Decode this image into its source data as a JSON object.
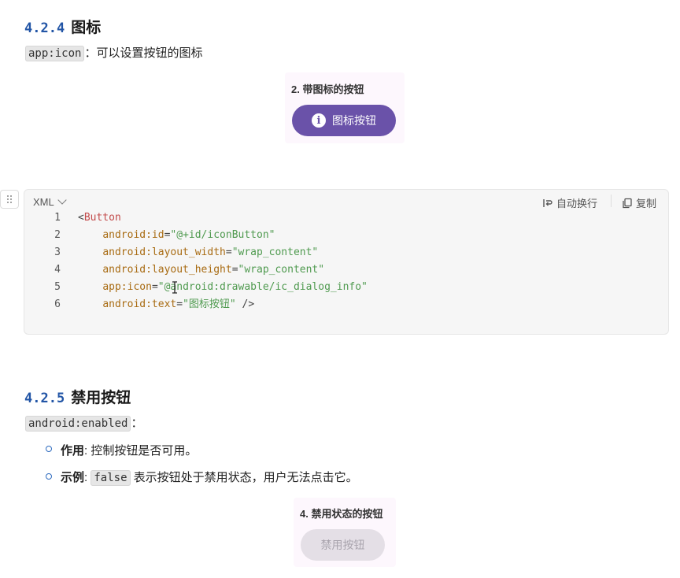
{
  "section_icon": {
    "number": "4.2.4",
    "title": "图标",
    "attr_code": "app:icon",
    "attr_desc": "：可以设置按钮的图标",
    "demo": {
      "title": "2. 带图标的按钮",
      "button_label": "图标按钮",
      "button_icon": "info-icon",
      "button_color": "#6a52a9"
    }
  },
  "code_block": {
    "language": "XML",
    "wrap_label": "自动换行",
    "copy_label": "复制",
    "lines": [
      {
        "n": "1",
        "parts": [
          [
            "pun",
            "<"
          ],
          [
            "tag",
            "Button"
          ]
        ]
      },
      {
        "n": "2",
        "parts": [
          [
            "pun",
            "    "
          ],
          [
            "attr",
            "android:id"
          ],
          [
            "pun",
            "="
          ],
          [
            "str",
            "\"@+id/iconButton\""
          ]
        ]
      },
      {
        "n": "3",
        "parts": [
          [
            "pun",
            "    "
          ],
          [
            "attr",
            "android:layout_width"
          ],
          [
            "pun",
            "="
          ],
          [
            "str",
            "\"wrap_content\""
          ]
        ]
      },
      {
        "n": "4",
        "parts": [
          [
            "pun",
            "    "
          ],
          [
            "attr",
            "android:layout_height"
          ],
          [
            "pun",
            "="
          ],
          [
            "str",
            "\"wrap_content\""
          ]
        ]
      },
      {
        "n": "5",
        "parts": [
          [
            "pun",
            "    "
          ],
          [
            "attr",
            "app:icon"
          ],
          [
            "pun",
            "="
          ],
          [
            "str",
            "\"@android:drawable/ic_dialog_info\""
          ]
        ]
      },
      {
        "n": "6",
        "parts": [
          [
            "pun",
            "    "
          ],
          [
            "attr",
            "android:text"
          ],
          [
            "pun",
            "="
          ],
          [
            "str",
            "\"图标按钮\""
          ],
          [
            "pun",
            " />"
          ]
        ]
      }
    ]
  },
  "section_disabled": {
    "number": "4.2.5",
    "title": "禁用按钮",
    "attr_code": "android:enabled",
    "attr_suffix": "：",
    "bullets": [
      {
        "label": "作用",
        "sep": ": ",
        "text": "控制按钮是否可用。"
      },
      {
        "label": "示例",
        "sep": ": ",
        "code": "false",
        "text": " 表示按钮处于禁用状态，用户无法点击它。"
      }
    ],
    "demo": {
      "title": "4. 禁用状态的按钮",
      "button_label": "禁用按钮"
    }
  }
}
